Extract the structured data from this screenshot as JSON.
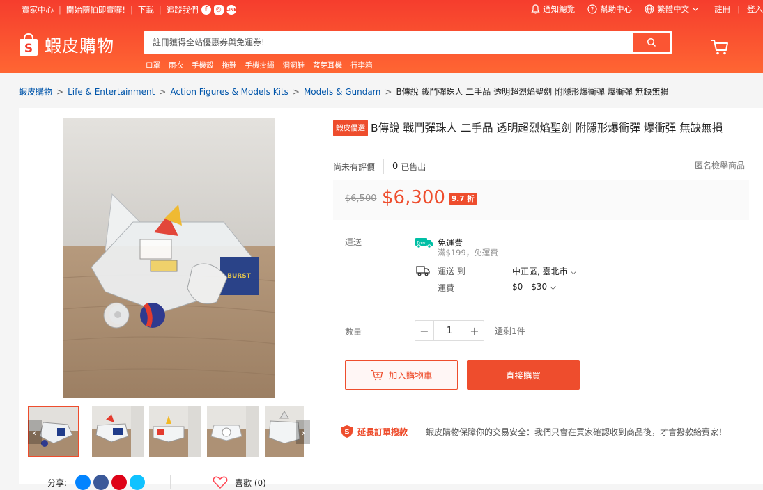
{
  "header": {
    "top_left": [
      "賣家中心",
      "開始隨拍即賣囉!",
      "下載",
      "追蹤我們"
    ],
    "social_icons": [
      "facebook-icon",
      "instagram-icon",
      "line-icon"
    ],
    "top_right": [
      "通知總覽",
      "幫助中心",
      "繁體中文",
      "註冊",
      "登入"
    ],
    "logo_text": "蝦皮購物",
    "search_placeholder": "註冊獲得全站優惠券與免運券!",
    "hotwords": [
      "口罩",
      "雨衣",
      "手機殼",
      "拖鞋",
      "手機掛繩",
      "洞洞鞋",
      "藍芽耳機",
      "行李箱"
    ],
    "brand_color": "#ee4d2d"
  },
  "breadcrumb": [
    "蝦皮購物",
    "Life & Entertainment",
    "Action Figures & Models Kits",
    "Models & Gundam",
    "B傳說 戰鬥彈珠人 二手品 透明超烈焰聖劍 附隱形爆衝彈 爆衝彈 無缺無損"
  ],
  "product": {
    "badge": "蝦皮優選",
    "title": "B傳說 戰鬥彈珠人 二手品 透明超烈焰聖劍 附隱形爆衝彈 爆衝彈 無缺無損",
    "rating": "尚未有評價",
    "sold_count": "0",
    "sold_label": "已售出",
    "report": "匿名檢舉商品",
    "old_price": "$6,500",
    "price": "$6,300",
    "discount": "9.7 折",
    "shipping_label": "運送",
    "free_ship_title": "免運費",
    "free_ship_badge": "Free",
    "free_ship_sub": "滿$199，免運費",
    "ship_to_label": "運送 到",
    "ship_to_value": "中正區, 臺北市",
    "ship_fee_label": "運費",
    "ship_fee_value": "$0 - $30",
    "quantity_label": "數量",
    "quantity": "1",
    "stock": "還剩1件",
    "add_to_cart": "加入購物車",
    "buy_now": "直接購買",
    "guarantee_title": "延長訂單撥款",
    "guarantee_text": "蝦皮購物保障你的交易安全：我們只會在買家確認收到商品後，才會撥款給賣家！"
  },
  "share": {
    "label": "分享:",
    "like": "喜歡 (0)"
  }
}
